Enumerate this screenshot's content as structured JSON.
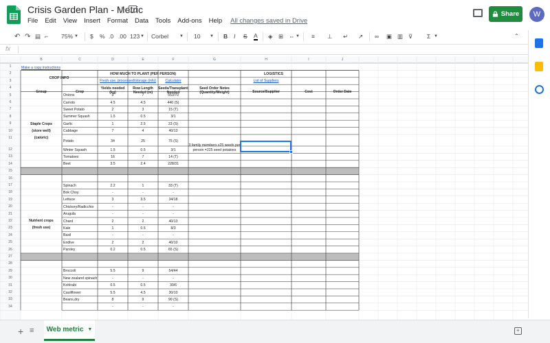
{
  "app": {
    "title": "Crisis Garden Plan - Metric",
    "menu": [
      "File",
      "Edit",
      "View",
      "Insert",
      "Format",
      "Data",
      "Tools",
      "Add-ons",
      "Help"
    ],
    "saved_status": "All changes saved in Drive",
    "share_label": "Share",
    "avatar_letter": "W",
    "brand_color": "#0f9d58"
  },
  "toolbar": {
    "zoom": "75%",
    "currency": "$",
    "percent": "%",
    "dec_decrease": ".0",
    "dec_increase": ".00",
    "more_formats": "123",
    "font": "Corbel",
    "font_size": "10",
    "bold": "B",
    "italic": "I",
    "strike": "S",
    "text_color": "A",
    "function": "Σ"
  },
  "formula_bar": {
    "label": "fx",
    "value": ""
  },
  "grid": {
    "columns": [
      "A",
      "B",
      "C",
      "D",
      "E",
      "F",
      "G",
      "H",
      "I",
      "J"
    ],
    "row_numbers": [
      "1",
      "2",
      "3",
      "4",
      "5",
      "6",
      "7",
      "8",
      "9",
      "10",
      "11",
      "12",
      "13",
      "14",
      "15",
      "16",
      "17",
      "18",
      "19",
      "20",
      "21",
      "22",
      "23",
      "24",
      "25",
      "26",
      "27",
      "28",
      "29",
      "30",
      "31",
      "32",
      "33",
      "34"
    ],
    "copy_link": "Make a copy instructions",
    "crop_info": "CROP INFO",
    "how_much": "HOW MUCH TO PLANT (PER PERSON)",
    "logistics": "LOGISTICS",
    "fresh_use_link": "Fresh use, processed/storage (info)",
    "calculator_link": "Calculator",
    "suppliers_link": "List of Suppliers",
    "headers": {
      "group": "Group",
      "crop": "Crop",
      "yields": "Yields needed (kg)",
      "row_length": "Row Length Needed (m)",
      "seeds": "Seeds/Transplants Needed",
      "seed_notes": "Seed Order Notes (Quantity/Weight)",
      "source": "Source/Supplier",
      "cost": "Cost",
      "order_date": "Order Date"
    },
    "staple_group": [
      "Staple Crops",
      "(store well)",
      "(caloric)"
    ],
    "nutrient_group": [
      "Nutrient crops",
      "(fresh use)"
    ],
    "seed_note_text": [
      "3 family members x25 seeds per",
      "person =225 seed potatoes"
    ],
    "staple_rows": [
      {
        "crop": "Onions",
        "yield": "9",
        "row": "7",
        "seeds": "553/70"
      },
      {
        "crop": "Carrots",
        "yield": "4.5",
        "row": "4.5",
        "seeds": "440 (S)"
      },
      {
        "crop": "Sweet Potato",
        "yield": "2",
        "row": "3",
        "seeds": "15 (T)"
      },
      {
        "crop": "Summer Squash",
        "yield": "1.5",
        "row": "0.5",
        "seeds": "3/1"
      },
      {
        "crop": "Garlic",
        "yield": "1",
        "row": "2.5",
        "seeds": "23 (S)"
      },
      {
        "crop": "Cabbage",
        "yield": "7",
        "row": "4",
        "seeds": "40/13"
      },
      {
        "crop": "Potato",
        "yield": "34",
        "row": "25",
        "seeds": "75 (S)"
      },
      {
        "crop": "Winter Squash",
        "yield": "1.5",
        "row": "0.5",
        "seeds": "3/1"
      },
      {
        "crop": "Tomatoes",
        "yield": "16",
        "row": "7",
        "seeds": "14 (T)"
      },
      {
        "crop": "Beet",
        "yield": "3.5",
        "row": "2.4",
        "seeds": "228/31"
      }
    ],
    "nutrient_rows": [
      {
        "crop": "Spinach",
        "yield": "2.2",
        "row": "1",
        "seeds": "33 (T)"
      },
      {
        "crop": "Bok Choy",
        "yield": "-",
        "row": "-",
        "seeds": "-"
      },
      {
        "crop": "Lettuce",
        "yield": "3",
        "row": "3.5",
        "seeds": "34/18"
      },
      {
        "crop": "Chickory/Radicchio",
        "yield": "-",
        "row": "-",
        "seeds": "-"
      },
      {
        "crop": "Arugula",
        "yield": "-",
        "row": "-",
        "seeds": "-"
      },
      {
        "crop": "Chard",
        "yield": "2",
        "row": "2",
        "seeds": "40/13"
      },
      {
        "crop": "Kale",
        "yield": "1",
        "row": "0.5",
        "seeds": "8/3"
      },
      {
        "crop": "Basil",
        "yield": "-",
        "row": "-",
        "seeds": "-"
      },
      {
        "crop": "Endive",
        "yield": "2",
        "row": "2",
        "seeds": "40/10"
      },
      {
        "crop": "Parsley",
        "yield": "0.2",
        "row": "0.5",
        "seeds": "65 (S)"
      }
    ],
    "third_rows": [
      {
        "crop": "Broccoli",
        "yield": "5.5",
        "row": "9",
        "seeds": "54/44"
      },
      {
        "crop": "New zealand spinach",
        "yield": "-",
        "row": "-",
        "seeds": "-"
      },
      {
        "crop": "Kohlrabi",
        "yield": "0.5",
        "row": "0.5",
        "seeds": "30/6"
      },
      {
        "crop": "Cauliflower",
        "yield": "5.5",
        "row": "4.5",
        "seeds": "30/10"
      },
      {
        "crop": "Beans,dry",
        "yield": "8",
        "row": "9",
        "seeds": "90 (S)"
      },
      {
        "crop": "",
        "yield": "-",
        "row": "-",
        "seeds": "-"
      }
    ]
  },
  "sheet_tab": {
    "label": "Web metric"
  }
}
